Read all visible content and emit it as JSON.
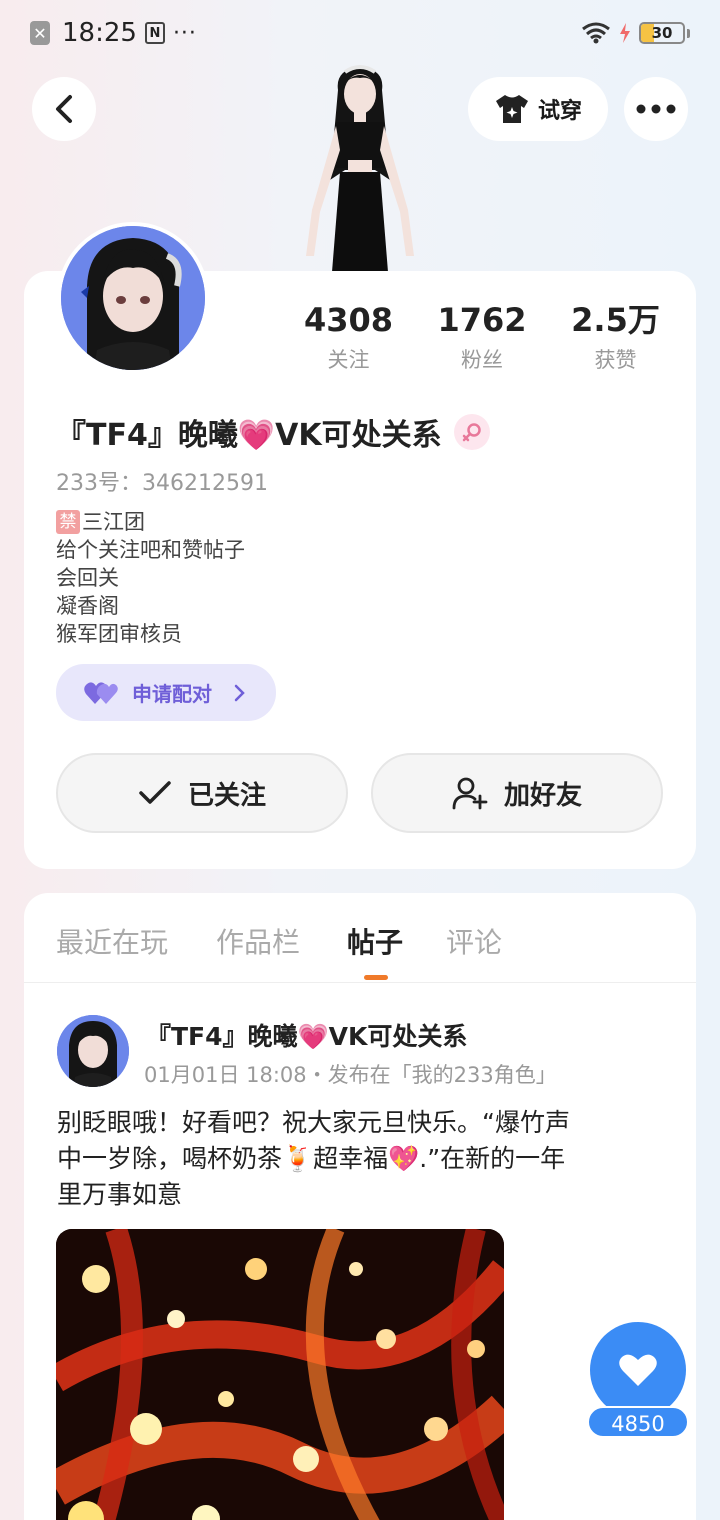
{
  "status_bar": {
    "time": "18:25",
    "nfc": "N",
    "dots": "···",
    "battery": "30",
    "battery_fraction": 0.3
  },
  "header": {
    "back_icon": "chevron-left-icon",
    "tryon_label": "试穿",
    "more_icon": "more-dots-icon"
  },
  "profile": {
    "stats": [
      {
        "value": "4308",
        "label": "关注"
      },
      {
        "value": "1762",
        "label": "粉丝"
      },
      {
        "value": "2.5万",
        "label": "获赞"
      }
    ],
    "nickname": "『TF4』晚曦💗VK可处关系",
    "gender_icon": "female-icon",
    "uid": "233号：346212591",
    "bio": {
      "ban_tag": "禁",
      "lines": [
        "三江团",
        "给个关注吧和赞帖子",
        "会回关",
        "凝香阁",
        "猴军团审核员"
      ]
    },
    "pair_label": "申请配对",
    "follow_label": "已关注",
    "friend_label": "加好友"
  },
  "tabs": [
    "最近在玩",
    "作品栏",
    "帖子",
    "评论"
  ],
  "active_tab": "帖子",
  "post": {
    "author": "『TF4』晚曦💗VK可处关系",
    "meta": "01月01日 18:08・发布在「我的233角色」",
    "text_lines": [
      "别眨眼哦！好看吧？祝大家元旦快乐。“爆竹声",
      "中一岁除，喝杯奶茶🍹超幸福💖.”在新的一年",
      "里万事如意"
    ]
  },
  "like_count": "4850",
  "colors": {
    "accent_blue": "#3b8cf5",
    "tab_indicator": "#f07a2a",
    "pair_purple": "#6f5fd8",
    "pair_bg": "#e8e7fb"
  }
}
